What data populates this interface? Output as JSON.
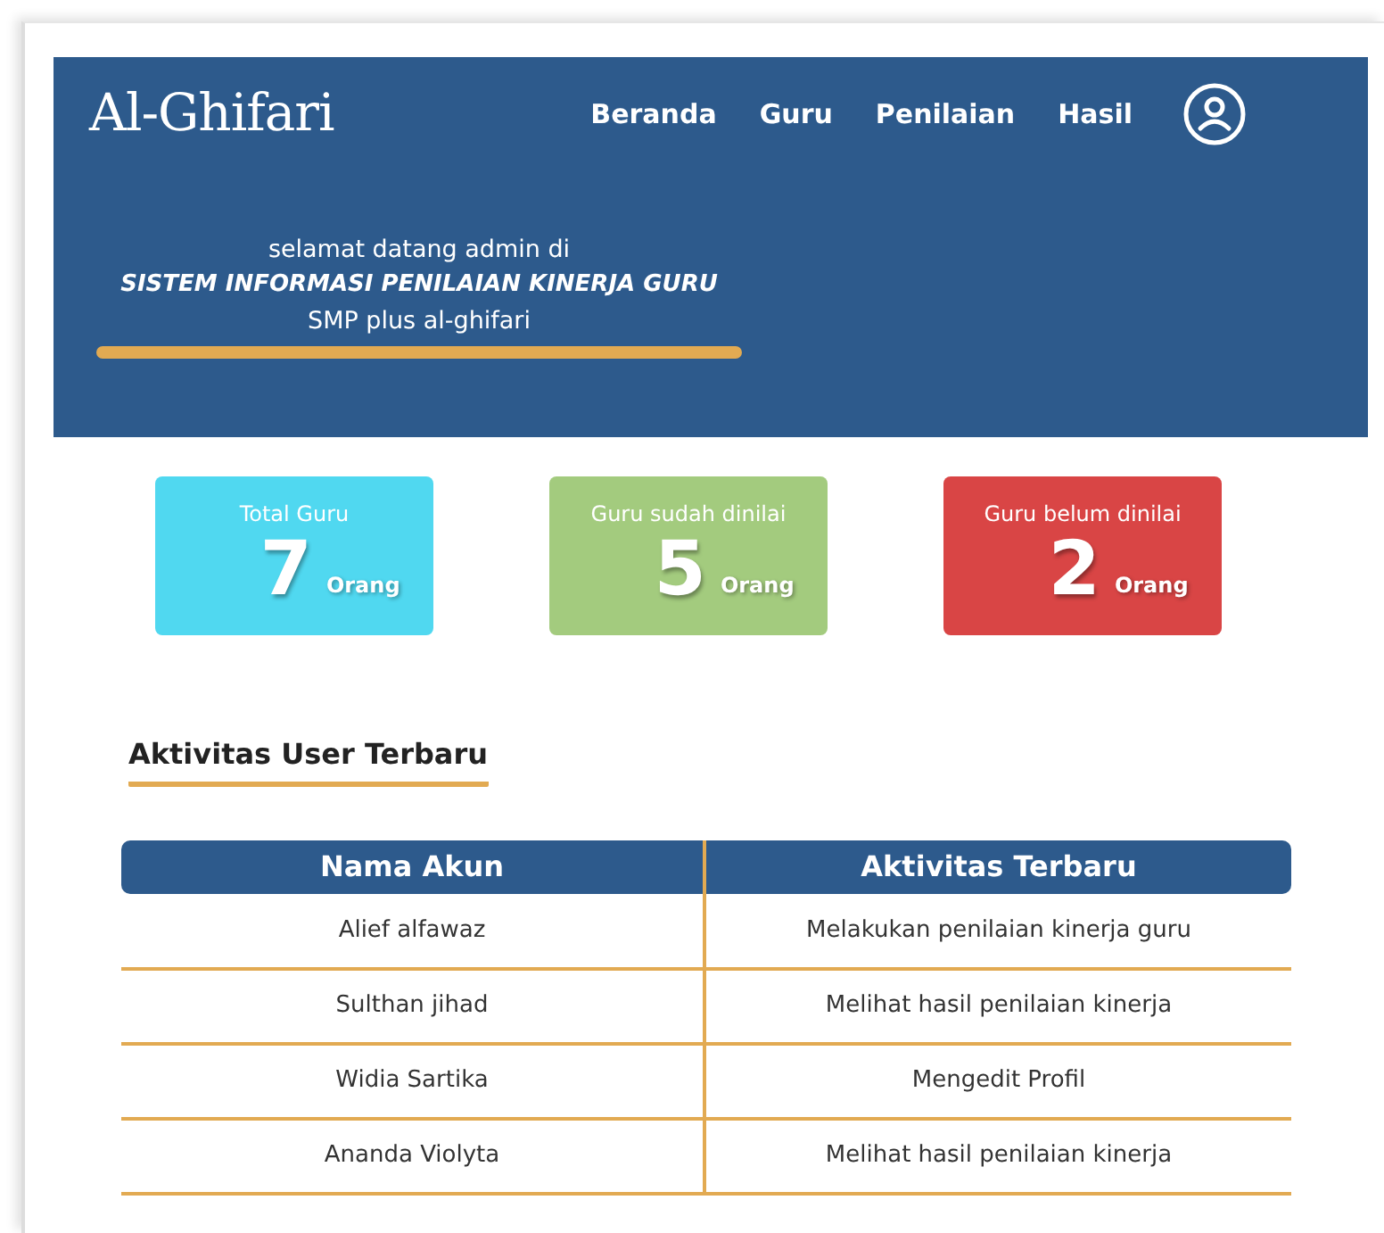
{
  "header": {
    "logo": "Al-Ghifari",
    "nav": [
      "Beranda",
      "Guru",
      "Penilaian",
      "Hasil"
    ],
    "welcome": {
      "line_1": "selamat datang admin di",
      "line_2": "SISTEM INFORMASI PENILAIAN KINERJA GURU",
      "line_3": "SMP plus al-ghifari"
    }
  },
  "stats": [
    {
      "label": "Total Guru",
      "value": "7",
      "unit": "Orang",
      "color": "#50d8f0"
    },
    {
      "label": "Guru sudah dinilai",
      "value": "5",
      "unit": "Orang",
      "color": "#a3cb7e"
    },
    {
      "label": "Guru belum dinilai",
      "value": "2",
      "unit": "Orang",
      "color": "#d94545"
    }
  ],
  "activity": {
    "title": "Aktivitas User Terbaru",
    "columns": [
      "Nama Akun",
      "Aktivitas Terbaru"
    ],
    "rows": [
      [
        "Alief alfawaz",
        "Melakukan penilaian kinerja guru"
      ],
      [
        "Sulthan jihad",
        "Melihat hasil penilaian kinerja"
      ],
      [
        "Widia Sartika",
        "Mengedit Profil"
      ],
      [
        "Ananda Violyta",
        "Melihat hasil penilaian kinerja"
      ]
    ]
  }
}
